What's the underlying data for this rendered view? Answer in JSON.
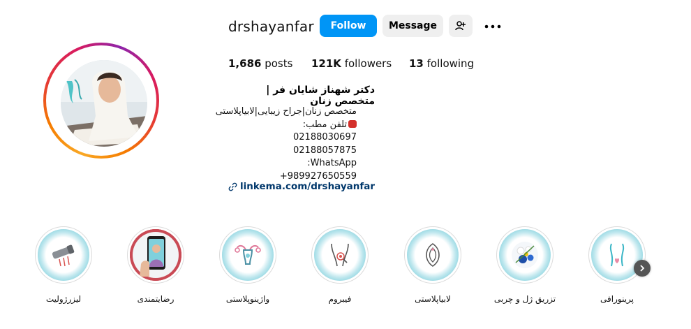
{
  "profile": {
    "username": "drshayanfar",
    "buttons": {
      "follow": "Follow",
      "message": "Message"
    },
    "stats": {
      "posts_value": "1,686",
      "posts_label": "posts",
      "followers_value": "121K",
      "followers_label": "followers",
      "following_value": "13",
      "following_label": "following"
    },
    "full_name": "دکتر شهناز شایان فر | متخصص زنان",
    "bio_lines": [
      "متخصص زنان|جراح زیبایی|لابیاپلاستی",
      "تلفن مطب:",
      "02188030697",
      "02188057875",
      "WhatsApp:",
      "989927650559+"
    ],
    "link": "linkema.com/drshayanfar"
  },
  "highlights": [
    {
      "label": "پرینورافی",
      "icon": "perineum-icon"
    },
    {
      "label": "تزریق ژل و چربی",
      "icon": "flowers-icon"
    },
    {
      "label": "لابیاپلاستی",
      "icon": "labia-icon"
    },
    {
      "label": "فیبروم",
      "icon": "pelvis-icon"
    },
    {
      "label": "واژینوپلاستی",
      "icon": "uterus-icon"
    },
    {
      "label": "رضایتمندی",
      "icon": "phone-hand-icon"
    },
    {
      "label": "لیزرژولیت",
      "icon": "laser-device-icon"
    }
  ],
  "colors": {
    "follow_button": "#0095f6",
    "secondary_button": "#efefef",
    "link": "#00376b",
    "highlight_accent": "#7fd0dc"
  }
}
